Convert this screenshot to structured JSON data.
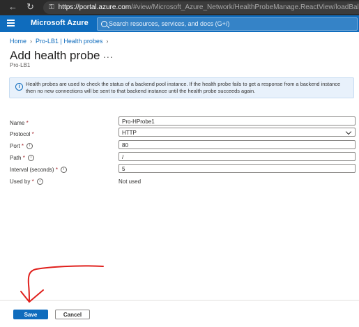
{
  "browser": {
    "url_host": "https://portal.azure.com",
    "url_path": "/#view/Microsoft_Azure_Network/HealthProbeManage.ReactView/loadBalancerId/%2F"
  },
  "topbar": {
    "brand": "Microsoft Azure",
    "search_placeholder": "Search resources, services, and docs (G+/)"
  },
  "breadcrumb": [
    "Home",
    "Pro-LB1 | Health probes"
  ],
  "page": {
    "title": "Add health probe",
    "more": "...",
    "subtitle": "Pro-LB1"
  },
  "info": {
    "text": "Health probes are used to check the status of a backend pool instance. If the health probe fails to get a response from a backend instance then no new connections will be sent to that backend instance until the health probe succeeds again."
  },
  "form": {
    "name": {
      "label": "Name",
      "value": "Pro-HProbe1"
    },
    "protocol": {
      "label": "Protocol",
      "value": "HTTP"
    },
    "port": {
      "label": "Port",
      "value": "80"
    },
    "path": {
      "label": "Path",
      "value": "/"
    },
    "interval": {
      "label": "Interval (seconds)",
      "value": "5"
    },
    "used_by": {
      "label": "Used by",
      "value": "Not used"
    }
  },
  "footer": {
    "save": "Save",
    "cancel": "Cancel"
  },
  "colors": {
    "accent": "#0f6cbd",
    "annotation": "#e0201c"
  }
}
